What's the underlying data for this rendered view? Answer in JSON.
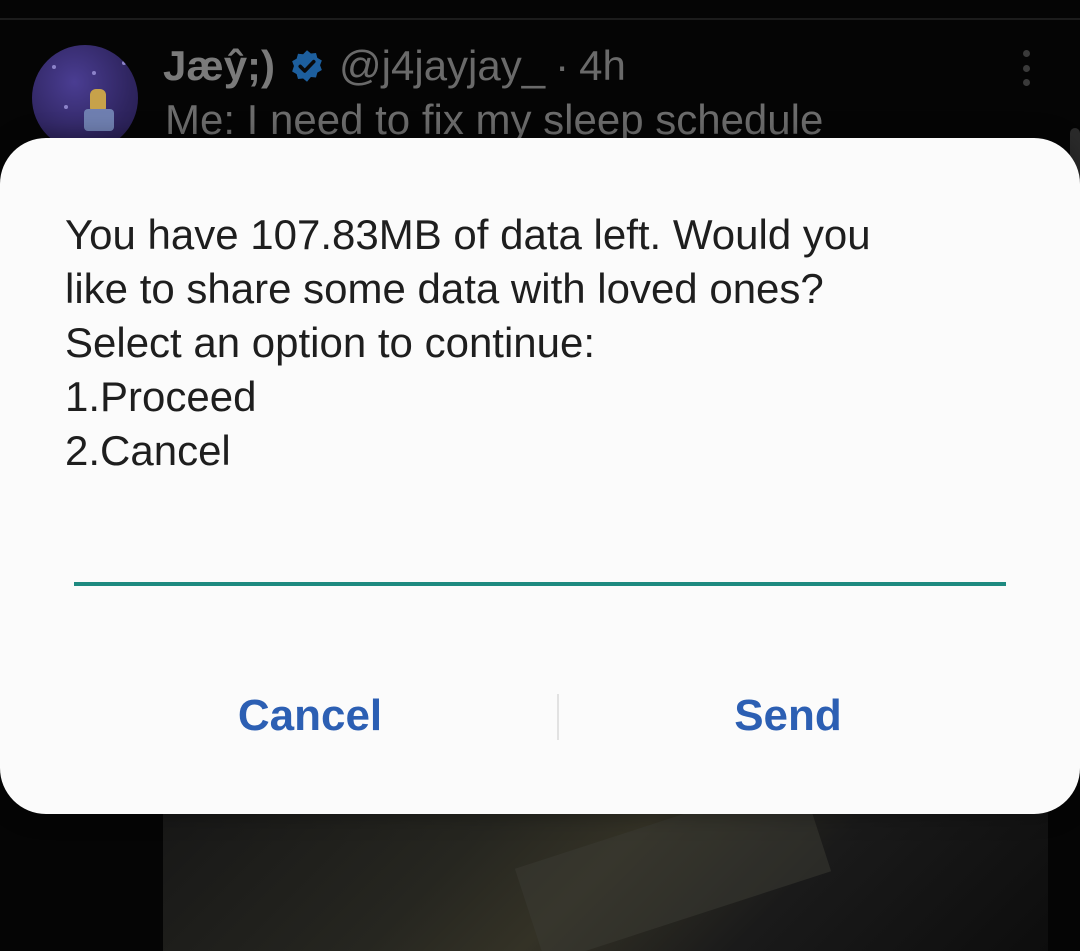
{
  "background_tweet": {
    "display_name": "Jæŷ;)",
    "handle": "@j4jayjay_",
    "separator": "·",
    "time": "4h",
    "text": "Me: I need to fix my sleep schedule",
    "verified_color": "#1d5f9e"
  },
  "dialog": {
    "message_lines": [
      "You have 107.83MB of data left. Would you",
      "like to share some data with loved ones?",
      "Select an option to continue:",
      "1.Proceed",
      "2.Cancel"
    ],
    "input_value": "",
    "input_placeholder": "",
    "cancel_label": "Cancel",
    "send_label": "Send",
    "accent_color": "#1e8a80",
    "button_color": "#2c5fb3"
  }
}
